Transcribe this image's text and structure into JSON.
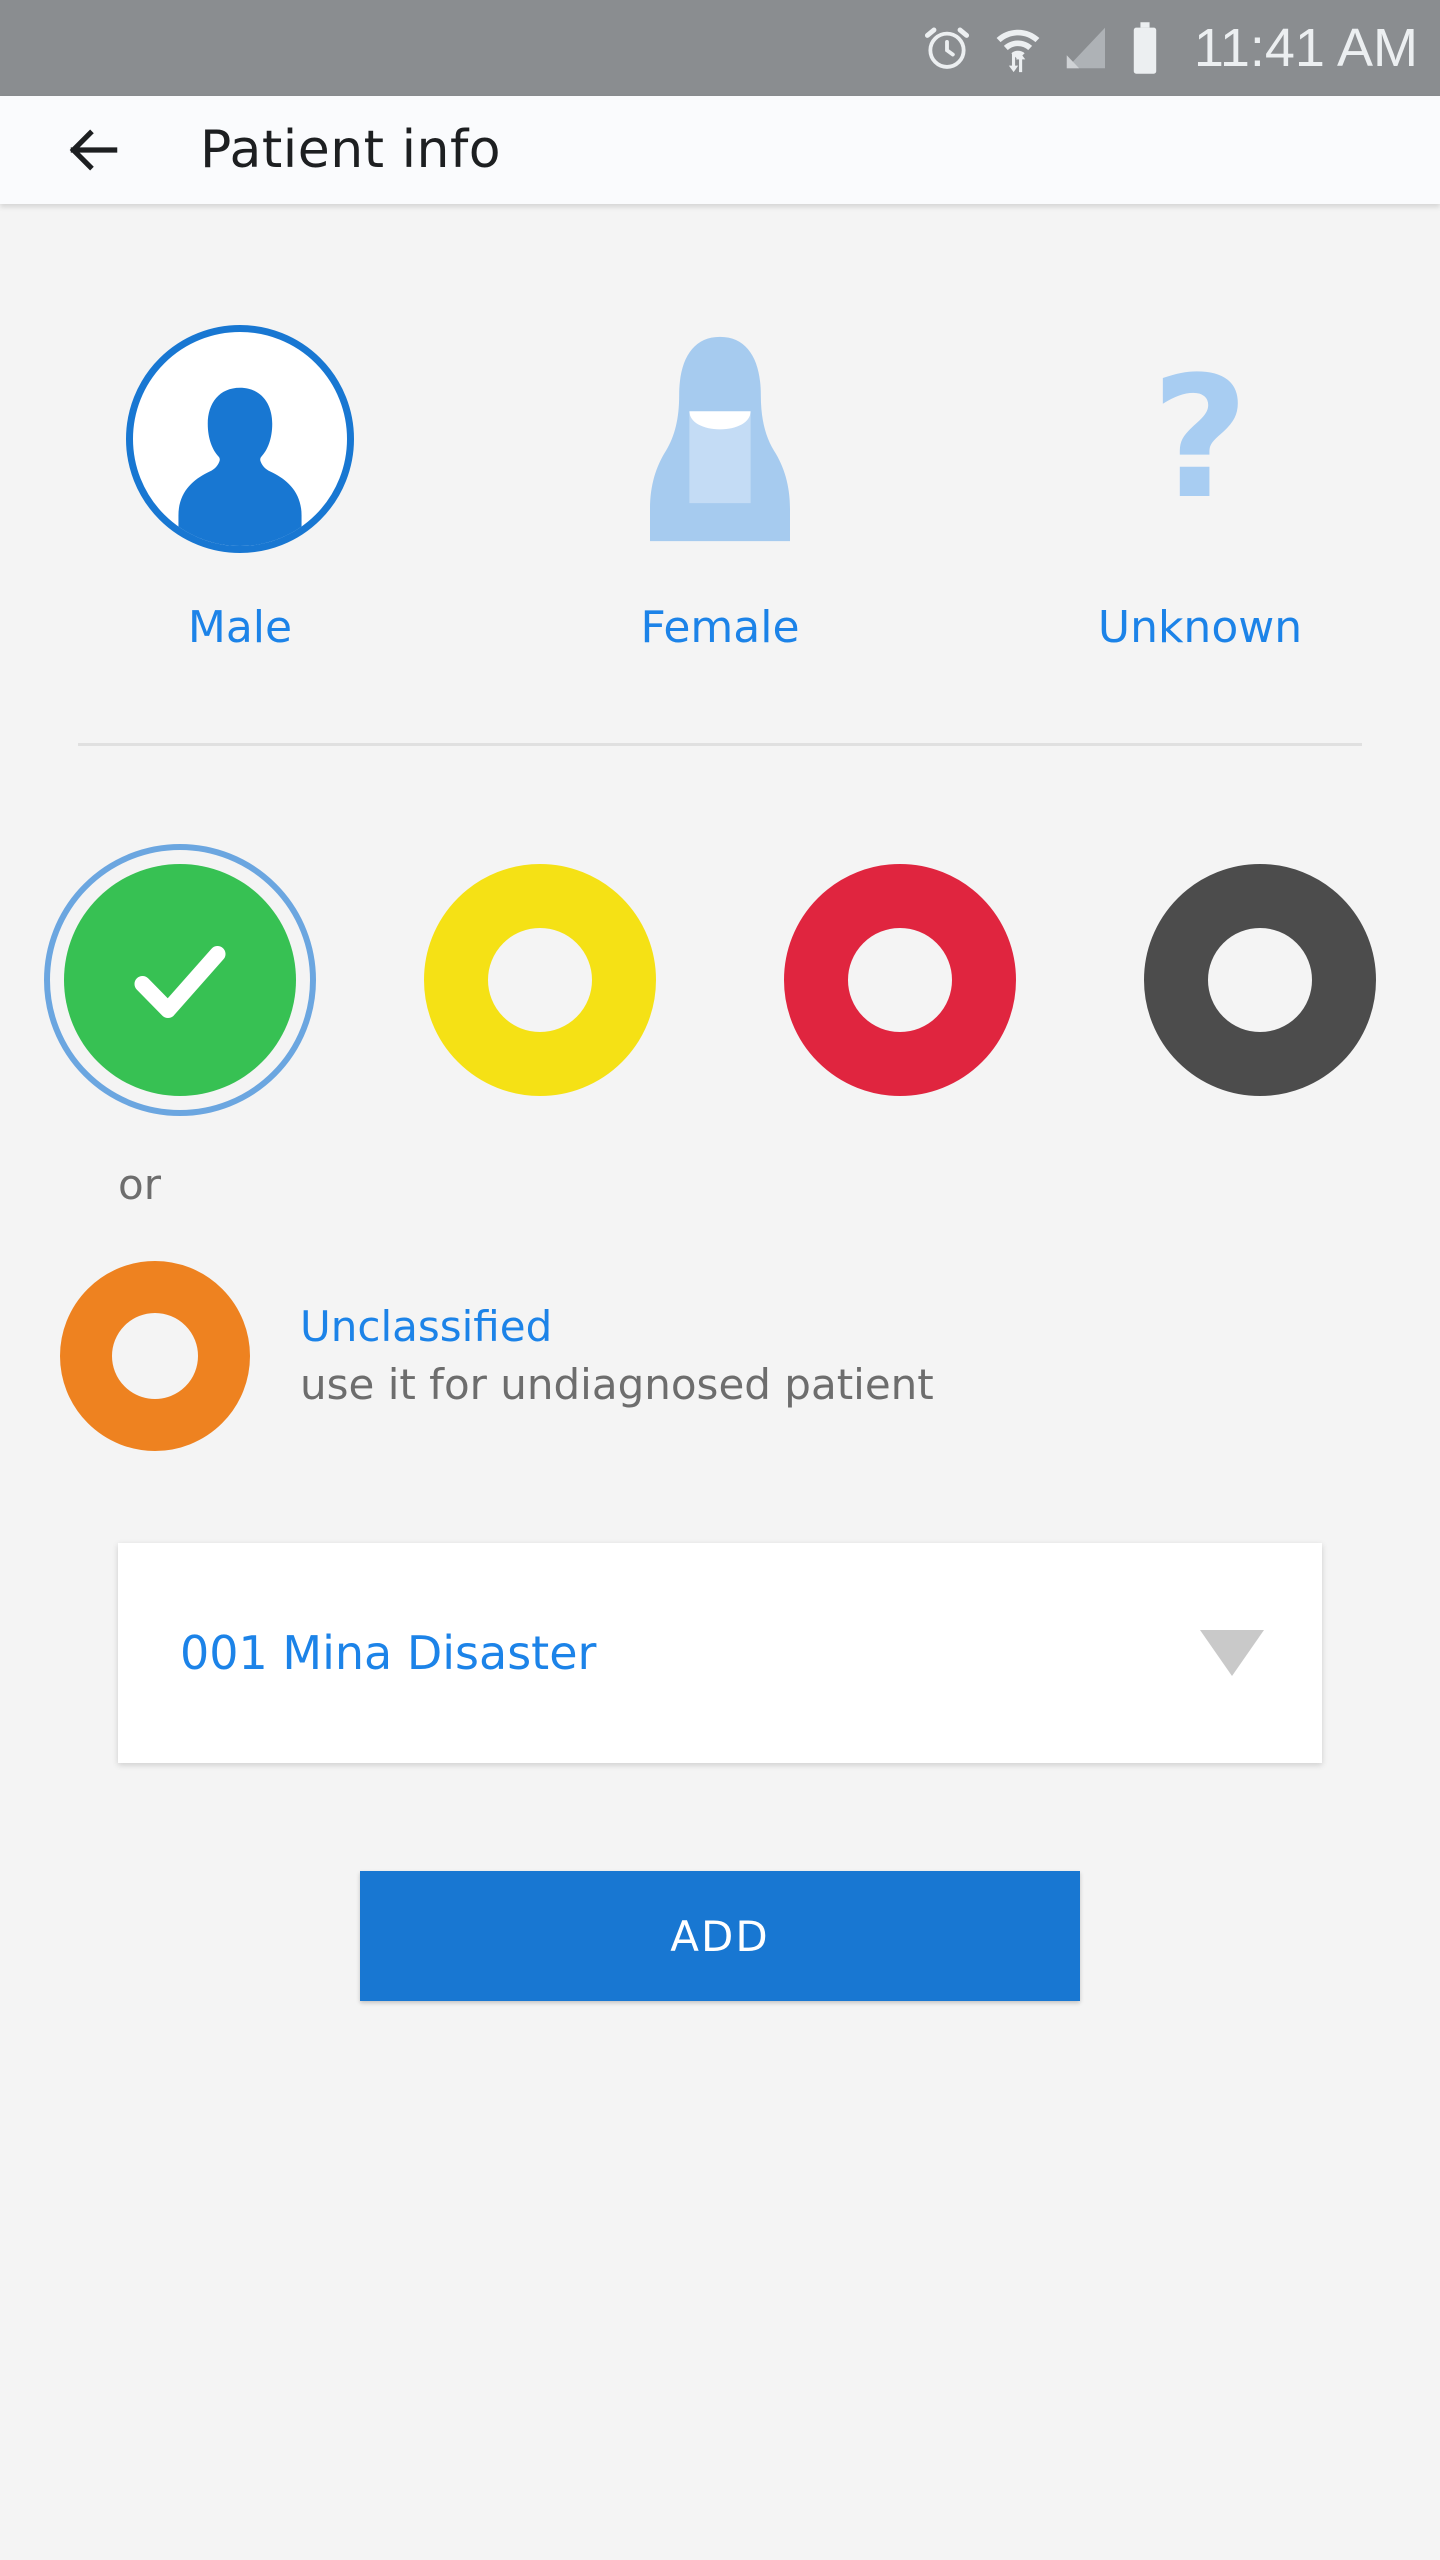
{
  "statusbar": {
    "time": "11:41 AM",
    "icons": [
      "alarm-clock-icon",
      "wifi-icon",
      "signal-icon",
      "battery-icon"
    ],
    "background_color": "#8a8d90"
  },
  "appbar": {
    "back_icon": "back-arrow-icon",
    "title": "Patient info",
    "background_color": "#fafbfd",
    "title_color": "#1d1f21"
  },
  "gender": {
    "selected": "Male",
    "options": [
      {
        "label": "Male",
        "icon": "male-avatar-icon",
        "selected": true
      },
      {
        "label": "Female",
        "icon": "female-veil-icon",
        "selected": false
      },
      {
        "label": "Unknown",
        "icon": "question-mark-icon",
        "glyph": "?",
        "selected": false
      }
    ],
    "label_color": "#1c83e8",
    "selected_color": "#1877d2",
    "unselected_color": "#a8cdf2"
  },
  "triage": {
    "selected_index": 0,
    "options": [
      {
        "name": "green",
        "color": "#37c153",
        "selected": true,
        "icon": "check-icon"
      },
      {
        "name": "yellow",
        "color": "#f5e115",
        "selected": false
      },
      {
        "name": "red",
        "color": "#e0253f",
        "selected": false
      },
      {
        "name": "black",
        "color": "#4c4c4c",
        "selected": false
      }
    ],
    "selection_ring_color": "#6ba6e0"
  },
  "or_label": "or",
  "unclassified": {
    "color": "#ee8220",
    "title": "Unclassified",
    "subtitle": "use it for undiagnosed patient",
    "title_color": "#1c83e8",
    "subtitle_color": "#6d6d6d"
  },
  "event_dropdown": {
    "value": "001 Mina Disaster",
    "caret_icon": "chevron-down-icon",
    "value_color": "#1c83e8"
  },
  "add_button": {
    "label": "ADD",
    "background_color": "#1877d2",
    "text_color": "#ffffff"
  }
}
